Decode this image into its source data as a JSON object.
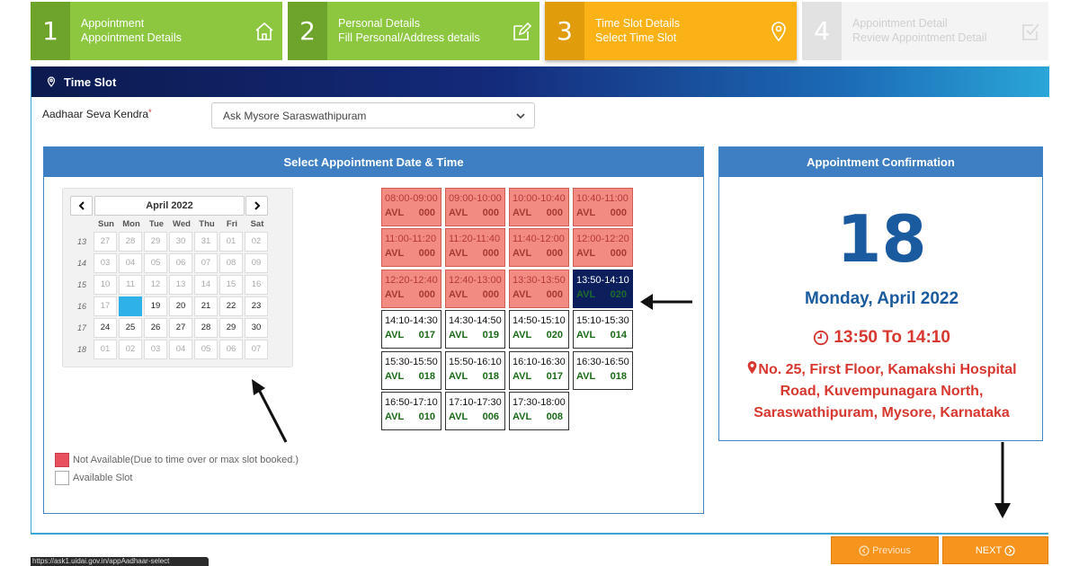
{
  "steps": [
    {
      "num": "1",
      "title": "Appointment",
      "subtitle": "Appointment Details",
      "icon": "home-icon",
      "state": "done"
    },
    {
      "num": "2",
      "title": "Personal Details",
      "subtitle": "Fill Personal/Address details",
      "icon": "edit-icon",
      "state": "done"
    },
    {
      "num": "3",
      "title": "Time Slot Details",
      "subtitle": "Select Time Slot",
      "icon": "map-pin-icon",
      "state": "active"
    },
    {
      "num": "4",
      "title": "Appointment Detail",
      "subtitle": "Review Appointment Detail",
      "icon": "check-square-icon",
      "state": "pending"
    }
  ],
  "timeslot": {
    "header": "Time Slot",
    "kendra_label": "Aadhaar Seva Kendra",
    "required_mark": "*",
    "kendra_value": "Ask Mysore Saraswathipuram"
  },
  "left_panel": {
    "title": "Select Appointment Date & Time"
  },
  "calendar": {
    "prev": "‹",
    "next": "›",
    "month": "April 2022",
    "weekdays": [
      "Sun",
      "Mon",
      "Tue",
      "Wed",
      "Thu",
      "Fri",
      "Sat"
    ],
    "weeks": [
      {
        "week": "13",
        "days": [
          "27",
          "28",
          "29",
          "30",
          "31",
          "01",
          "02"
        ]
      },
      {
        "week": "14",
        "days": [
          "03",
          "04",
          "05",
          "06",
          "07",
          "08",
          "09"
        ]
      },
      {
        "week": "15",
        "days": [
          "10",
          "11",
          "12",
          "13",
          "14",
          "15",
          "16"
        ]
      },
      {
        "week": "16",
        "days": [
          "17",
          "18",
          "19",
          "20",
          "21",
          "22",
          "23"
        ]
      },
      {
        "week": "17",
        "days": [
          "24",
          "25",
          "26",
          "27",
          "28",
          "29",
          "30"
        ]
      },
      {
        "week": "18",
        "days": [
          "01",
          "02",
          "03",
          "04",
          "05",
          "06",
          "07"
        ]
      }
    ],
    "selected": "18"
  },
  "slots": [
    {
      "time": "08:00-09:00",
      "avl": "AVL",
      "count": "000",
      "status": "na"
    },
    {
      "time": "09:00-10:00",
      "avl": "AVL",
      "count": "000",
      "status": "na"
    },
    {
      "time": "10:00-10:40",
      "avl": "AVL",
      "count": "000",
      "status": "na"
    },
    {
      "time": "10:40-11:00",
      "avl": "AVL",
      "count": "000",
      "status": "na"
    },
    {
      "time": "11:00-11:20",
      "avl": "AVL",
      "count": "000",
      "status": "na"
    },
    {
      "time": "11:20-11:40",
      "avl": "AVL",
      "count": "000",
      "status": "na"
    },
    {
      "time": "11:40-12:00",
      "avl": "AVL",
      "count": "000",
      "status": "na"
    },
    {
      "time": "12:00-12:20",
      "avl": "AVL",
      "count": "000",
      "status": "na"
    },
    {
      "time": "12:20-12:40",
      "avl": "AVL",
      "count": "000",
      "status": "na"
    },
    {
      "time": "12:40-13:00",
      "avl": "AVL",
      "count": "000",
      "status": "na"
    },
    {
      "time": "13:30-13:50",
      "avl": "AVL",
      "count": "000",
      "status": "na"
    },
    {
      "time": "13:50-14:10",
      "avl": "AVL",
      "count": "020",
      "status": "selected"
    },
    {
      "time": "14:10-14:30",
      "avl": "AVL",
      "count": "017",
      "status": "available"
    },
    {
      "time": "14:30-14:50",
      "avl": "AVL",
      "count": "019",
      "status": "available"
    },
    {
      "time": "14:50-15:10",
      "avl": "AVL",
      "count": "020",
      "status": "available"
    },
    {
      "time": "15:10-15:30",
      "avl": "AVL",
      "count": "014",
      "status": "available"
    },
    {
      "time": "15:30-15:50",
      "avl": "AVL",
      "count": "018",
      "status": "available"
    },
    {
      "time": "15:50-16:10",
      "avl": "AVL",
      "count": "018",
      "status": "available"
    },
    {
      "time": "16:10-16:30",
      "avl": "AVL",
      "count": "017",
      "status": "available"
    },
    {
      "time": "16:30-16:50",
      "avl": "AVL",
      "count": "018",
      "status": "available"
    },
    {
      "time": "16:50-17:10",
      "avl": "AVL",
      "count": "010",
      "status": "available"
    },
    {
      "time": "17:10-17:30",
      "avl": "AVL",
      "count": "006",
      "status": "available"
    },
    {
      "time": "17:30-18:00",
      "avl": "AVL",
      "count": "008",
      "status": "available"
    }
  ],
  "legend": {
    "not_available": "Not Available(Due to time over or max slot booked.)",
    "available": "Available Slot"
  },
  "confirmation": {
    "title": "Appointment Confirmation",
    "day": "18",
    "date": "Monday, April 2022",
    "time": "13:50 To 14:10",
    "address": "No. 25, First Floor, Kamakshi Hospital Road, Kuvempunagara North, Saraswathipuram, Mysore, Karnataka"
  },
  "buttons": {
    "previous": "Previous",
    "next": "NEXT"
  },
  "status_url": "https://ask1.uidai.gov.in/appAadhaar-select",
  "colors": {
    "step_done": "#8dc63f",
    "step_active": "#fbb216",
    "slot_not_available": "#f28b82",
    "slot_selected": "#0c1f5c",
    "button": "#f7941d",
    "panel_header": "#3d7fc2"
  }
}
